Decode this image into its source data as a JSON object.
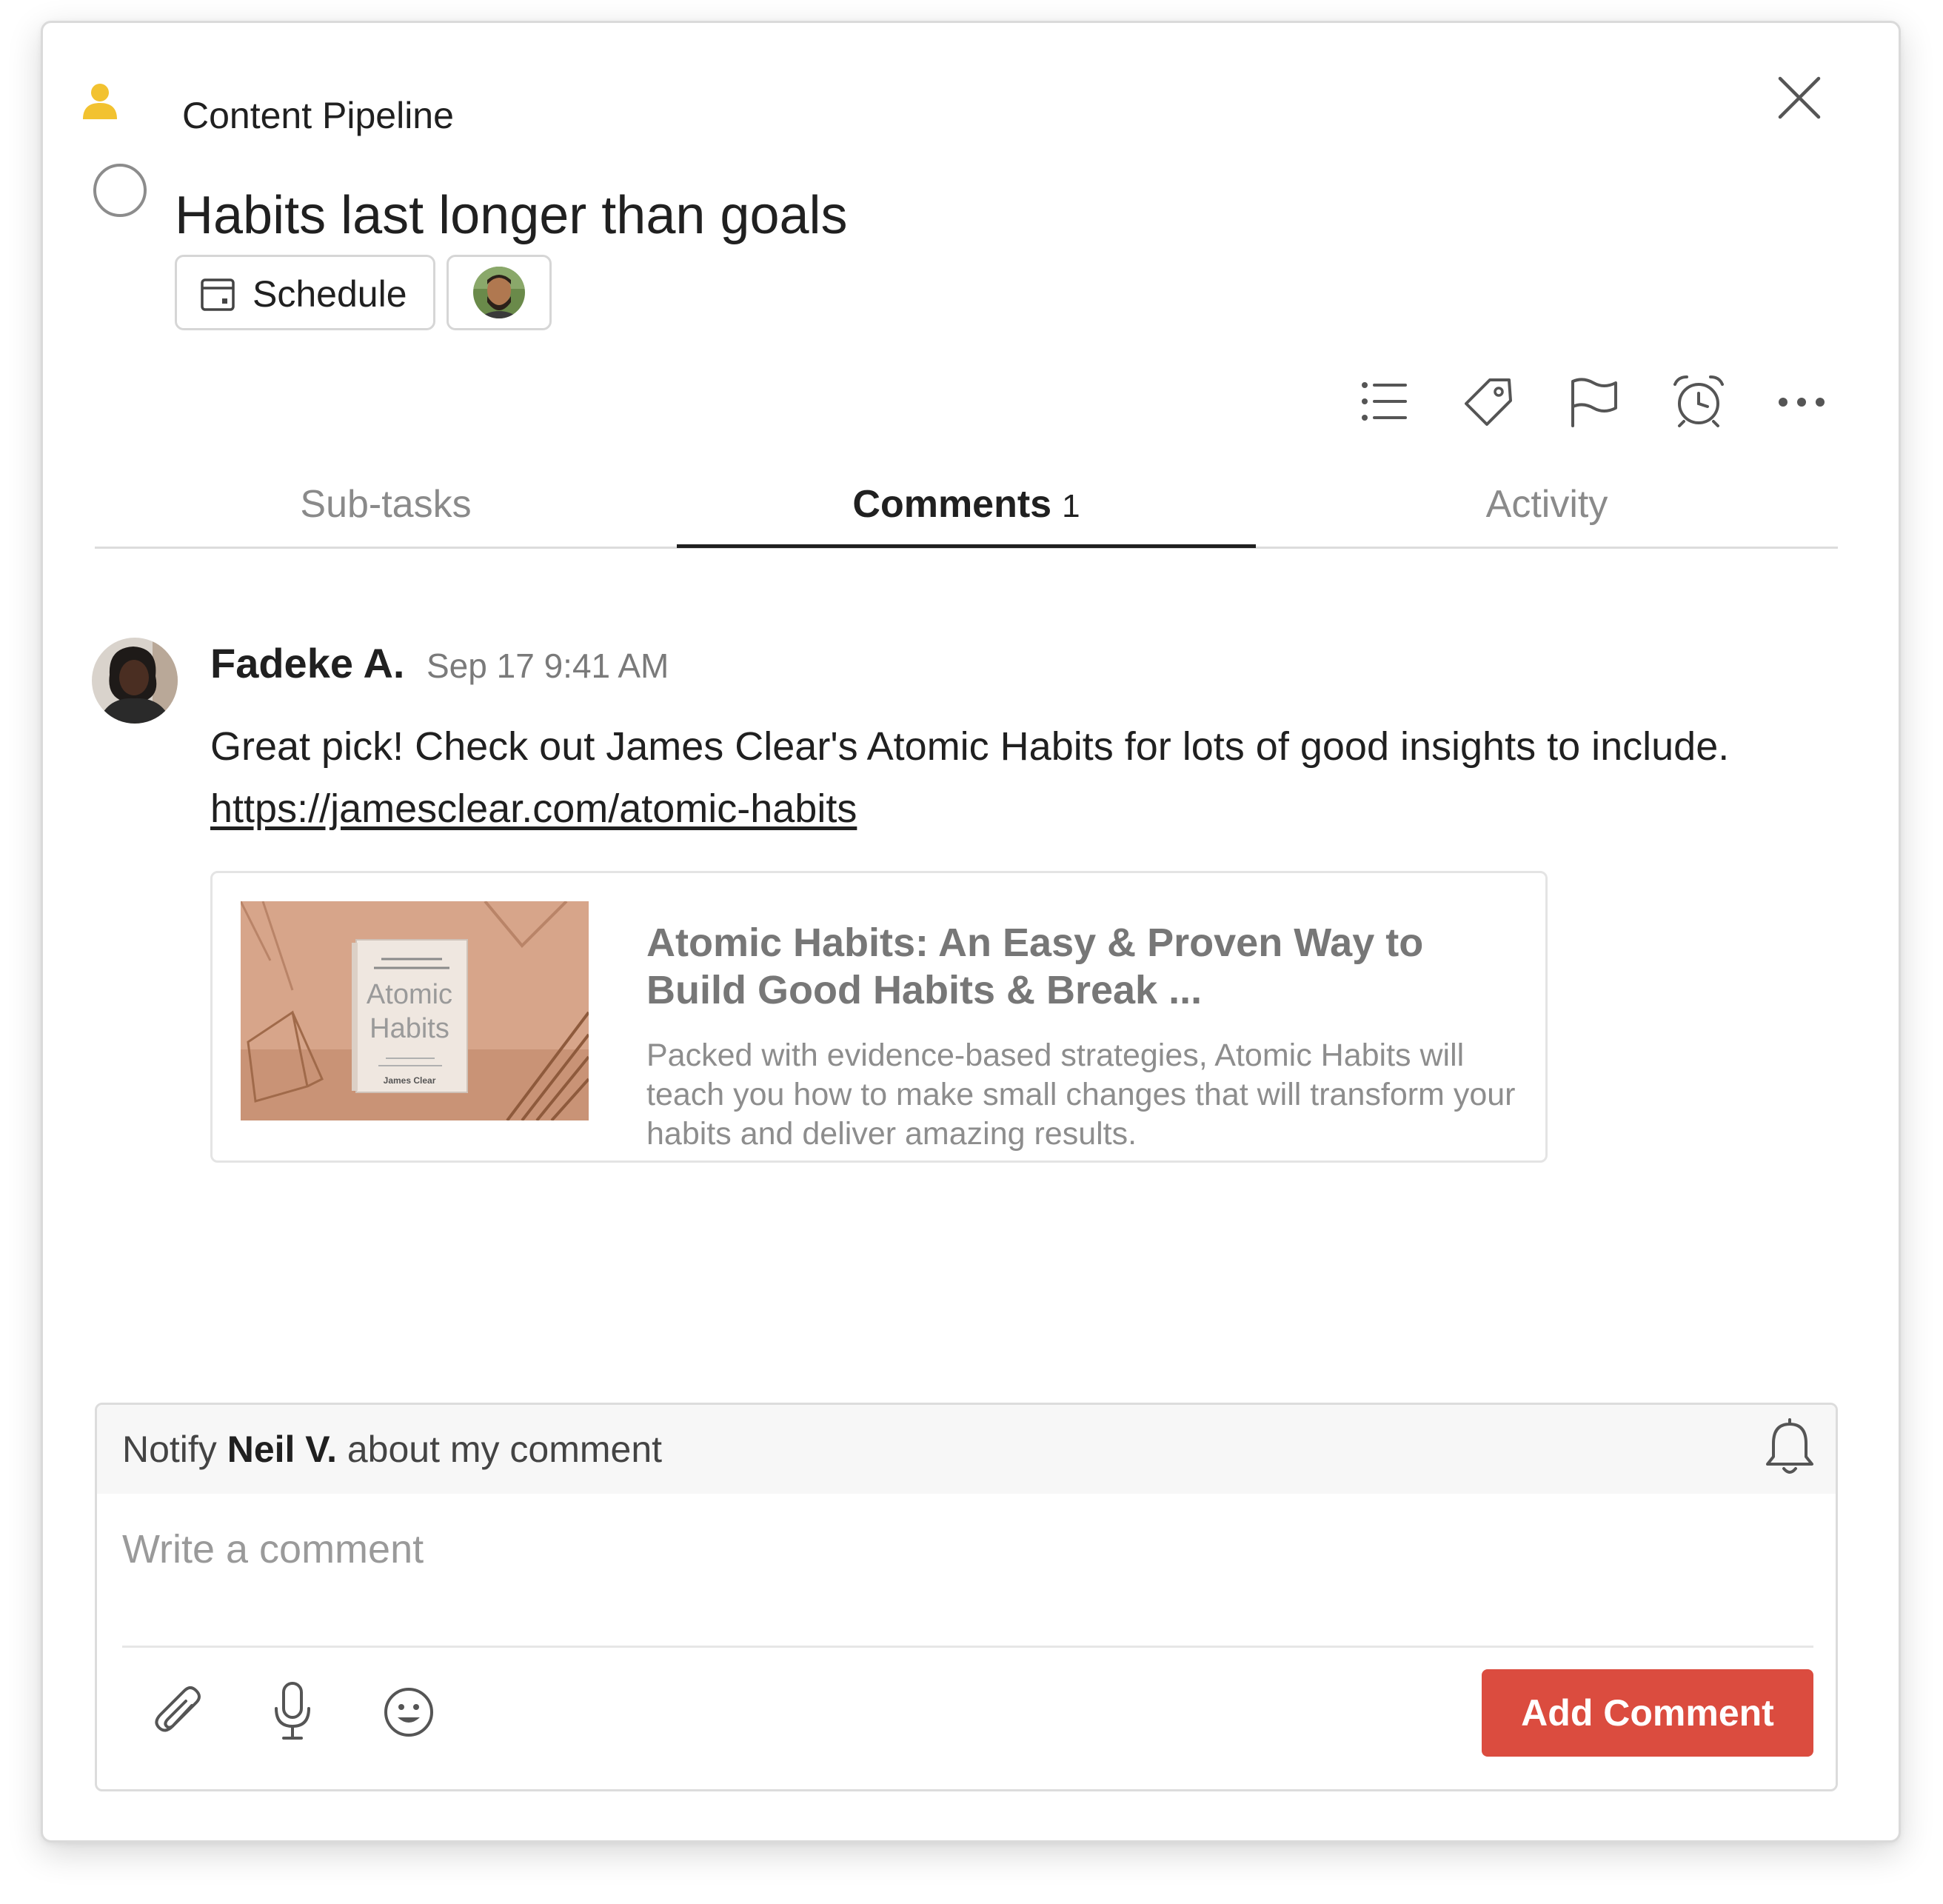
{
  "header": {
    "project_name": "Content Pipeline",
    "task_title": "Habits last longer than goals",
    "schedule_label": "Schedule"
  },
  "toolbar_icons": [
    "sub-task-list-icon",
    "label-tag-icon",
    "priority-flag-icon",
    "reminder-alarm-icon",
    "more-dots-icon"
  ],
  "tabs": [
    {
      "label": "Sub-tasks"
    },
    {
      "label": "Comments",
      "count": "1",
      "active": true
    },
    {
      "label": "Activity"
    }
  ],
  "comment": {
    "author": "Fadeke A.",
    "timestamp": "Sep 17 9:41 AM",
    "text": "Great pick! Check out James Clear's Atomic Habits for lots of good insights to include.",
    "link": "https://jamesclear.com/atomic-habits",
    "preview": {
      "title": "Atomic Habits: An Easy & Proven Way to Build Good Habits & Break ...",
      "description": "Packed with evidence-based strategies, Atomic Habits will teach you how to make small changes that will transform your habits and deliver amazing results.",
      "book_cover_text": [
        "Atomic",
        "Habits",
        "James Clear"
      ]
    }
  },
  "composer": {
    "notify_prefix": "Notify",
    "notify_name": "Neil V.",
    "notify_suffix": "about my comment",
    "placeholder": "Write a comment",
    "submit_label": "Add Comment"
  },
  "colors": {
    "accent_red": "#db4c3f",
    "project_icon_yellow": "#f2c230",
    "text_primary": "#202020",
    "text_secondary": "#8a8a8a"
  }
}
